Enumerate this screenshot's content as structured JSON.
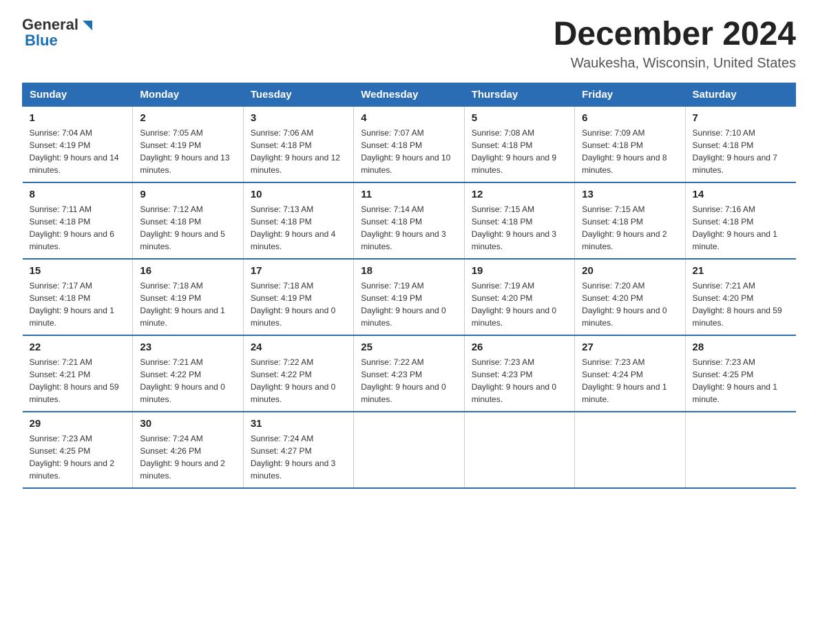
{
  "header": {
    "logo_general": "General",
    "logo_blue": "Blue",
    "month_title": "December 2024",
    "location": "Waukesha, Wisconsin, United States"
  },
  "days_of_week": [
    "Sunday",
    "Monday",
    "Tuesday",
    "Wednesday",
    "Thursday",
    "Friday",
    "Saturday"
  ],
  "weeks": [
    [
      {
        "day": "1",
        "sunrise": "7:04 AM",
        "sunset": "4:19 PM",
        "daylight": "9 hours and 14 minutes."
      },
      {
        "day": "2",
        "sunrise": "7:05 AM",
        "sunset": "4:19 PM",
        "daylight": "9 hours and 13 minutes."
      },
      {
        "day": "3",
        "sunrise": "7:06 AM",
        "sunset": "4:18 PM",
        "daylight": "9 hours and 12 minutes."
      },
      {
        "day": "4",
        "sunrise": "7:07 AM",
        "sunset": "4:18 PM",
        "daylight": "9 hours and 10 minutes."
      },
      {
        "day": "5",
        "sunrise": "7:08 AM",
        "sunset": "4:18 PM",
        "daylight": "9 hours and 9 minutes."
      },
      {
        "day": "6",
        "sunrise": "7:09 AM",
        "sunset": "4:18 PM",
        "daylight": "9 hours and 8 minutes."
      },
      {
        "day": "7",
        "sunrise": "7:10 AM",
        "sunset": "4:18 PM",
        "daylight": "9 hours and 7 minutes."
      }
    ],
    [
      {
        "day": "8",
        "sunrise": "7:11 AM",
        "sunset": "4:18 PM",
        "daylight": "9 hours and 6 minutes."
      },
      {
        "day": "9",
        "sunrise": "7:12 AM",
        "sunset": "4:18 PM",
        "daylight": "9 hours and 5 minutes."
      },
      {
        "day": "10",
        "sunrise": "7:13 AM",
        "sunset": "4:18 PM",
        "daylight": "9 hours and 4 minutes."
      },
      {
        "day": "11",
        "sunrise": "7:14 AM",
        "sunset": "4:18 PM",
        "daylight": "9 hours and 3 minutes."
      },
      {
        "day": "12",
        "sunrise": "7:15 AM",
        "sunset": "4:18 PM",
        "daylight": "9 hours and 3 minutes."
      },
      {
        "day": "13",
        "sunrise": "7:15 AM",
        "sunset": "4:18 PM",
        "daylight": "9 hours and 2 minutes."
      },
      {
        "day": "14",
        "sunrise": "7:16 AM",
        "sunset": "4:18 PM",
        "daylight": "9 hours and 1 minute."
      }
    ],
    [
      {
        "day": "15",
        "sunrise": "7:17 AM",
        "sunset": "4:18 PM",
        "daylight": "9 hours and 1 minute."
      },
      {
        "day": "16",
        "sunrise": "7:18 AM",
        "sunset": "4:19 PM",
        "daylight": "9 hours and 1 minute."
      },
      {
        "day": "17",
        "sunrise": "7:18 AM",
        "sunset": "4:19 PM",
        "daylight": "9 hours and 0 minutes."
      },
      {
        "day": "18",
        "sunrise": "7:19 AM",
        "sunset": "4:19 PM",
        "daylight": "9 hours and 0 minutes."
      },
      {
        "day": "19",
        "sunrise": "7:19 AM",
        "sunset": "4:20 PM",
        "daylight": "9 hours and 0 minutes."
      },
      {
        "day": "20",
        "sunrise": "7:20 AM",
        "sunset": "4:20 PM",
        "daylight": "9 hours and 0 minutes."
      },
      {
        "day": "21",
        "sunrise": "7:21 AM",
        "sunset": "4:20 PM",
        "daylight": "8 hours and 59 minutes."
      }
    ],
    [
      {
        "day": "22",
        "sunrise": "7:21 AM",
        "sunset": "4:21 PM",
        "daylight": "8 hours and 59 minutes."
      },
      {
        "day": "23",
        "sunrise": "7:21 AM",
        "sunset": "4:22 PM",
        "daylight": "9 hours and 0 minutes."
      },
      {
        "day": "24",
        "sunrise": "7:22 AM",
        "sunset": "4:22 PM",
        "daylight": "9 hours and 0 minutes."
      },
      {
        "day": "25",
        "sunrise": "7:22 AM",
        "sunset": "4:23 PM",
        "daylight": "9 hours and 0 minutes."
      },
      {
        "day": "26",
        "sunrise": "7:23 AM",
        "sunset": "4:23 PM",
        "daylight": "9 hours and 0 minutes."
      },
      {
        "day": "27",
        "sunrise": "7:23 AM",
        "sunset": "4:24 PM",
        "daylight": "9 hours and 1 minute."
      },
      {
        "day": "28",
        "sunrise": "7:23 AM",
        "sunset": "4:25 PM",
        "daylight": "9 hours and 1 minute."
      }
    ],
    [
      {
        "day": "29",
        "sunrise": "7:23 AM",
        "sunset": "4:25 PM",
        "daylight": "9 hours and 2 minutes."
      },
      {
        "day": "30",
        "sunrise": "7:24 AM",
        "sunset": "4:26 PM",
        "daylight": "9 hours and 2 minutes."
      },
      {
        "day": "31",
        "sunrise": "7:24 AM",
        "sunset": "4:27 PM",
        "daylight": "9 hours and 3 minutes."
      },
      null,
      null,
      null,
      null
    ]
  ]
}
